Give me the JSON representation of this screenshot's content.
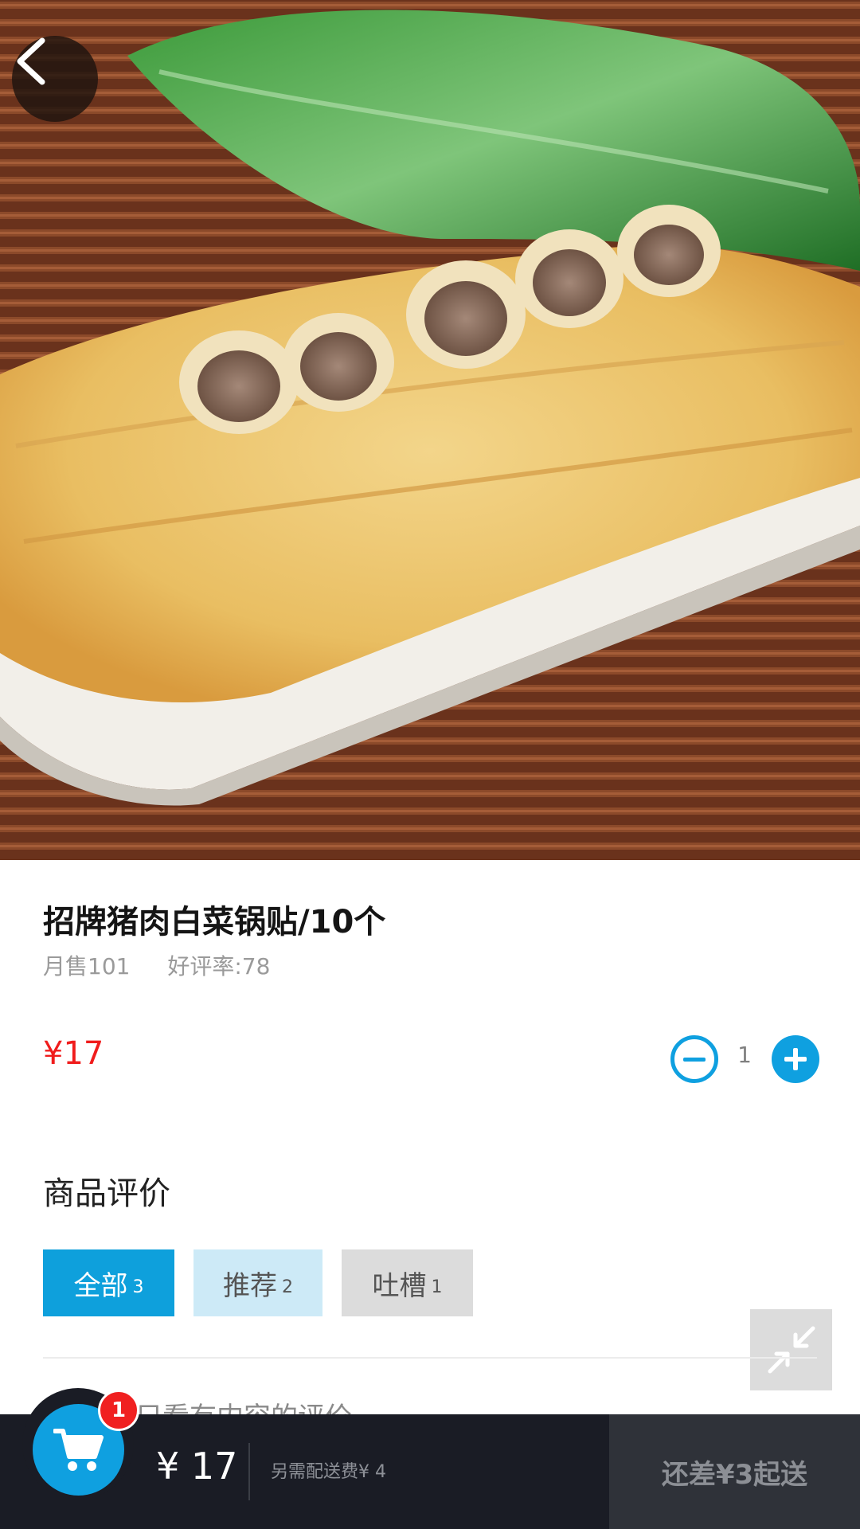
{
  "product": {
    "title": "招牌猪肉白菜锅贴/10个",
    "monthly_sales": "月售101",
    "rating": "好评率:78",
    "price": "¥17",
    "quantity": "1"
  },
  "reviews": {
    "section_title": "商品评价",
    "filters": [
      {
        "label": "全部",
        "count": "3"
      },
      {
        "label": "推荐",
        "count": "2"
      },
      {
        "label": "吐槽",
        "count": "1"
      }
    ],
    "content_only_label": "只看有内容的评价"
  },
  "cart": {
    "badge_count": "1",
    "total": "¥ 17",
    "delivery_fee": "另需配送费¥ 4",
    "submit_label": "还差¥3起送"
  },
  "colors": {
    "accent": "#0fa0e0",
    "price": "#f01c1c",
    "cart_bar": "#1a1c25"
  },
  "icons": {
    "back": "chevron-left-icon",
    "minus": "minus-circle-icon",
    "plus": "plus-circle-icon",
    "collapse": "collapse-arrows-icon",
    "cart": "shopping-cart-icon"
  }
}
